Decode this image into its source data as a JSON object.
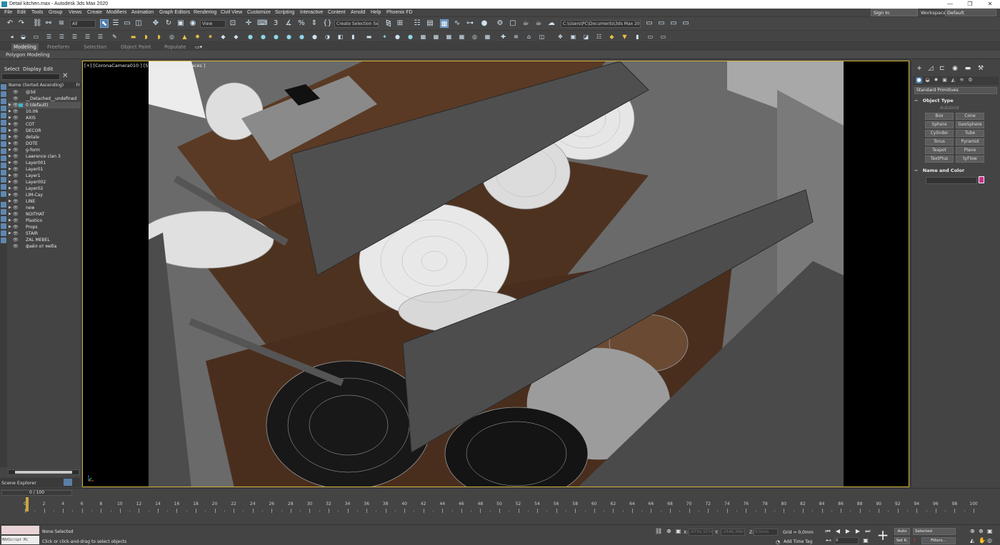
{
  "window": {
    "title": "Detail kitchen.max - Autodesk 3ds Max 2020",
    "minimize": "—",
    "maximize": "❐",
    "close": "✕"
  },
  "menu": [
    "File",
    "Edit",
    "Tools",
    "Group",
    "Views",
    "Create",
    "Modifiers",
    "Animation",
    "Graph Editors",
    "Rendering",
    "Civil View",
    "Customize",
    "Scripting",
    "Interactive",
    "Content",
    "Arnold",
    "Help",
    "Phoenix FD"
  ],
  "account": {
    "sign_in": "Sign In",
    "workspaces_label": "Workspaces:",
    "workspace": "Default"
  },
  "toolbar": {
    "filter": "All",
    "view": "View",
    "selection_set": "Create Selection Set",
    "project_path": "C:\\Users\\PC\\Documents\\3ds Max 2020"
  },
  "ribbon": {
    "tabs": [
      "Modeling",
      "Freeform",
      "Selection",
      "Object Paint",
      "Populate"
    ],
    "active_tab": "Modeling",
    "panel": "Polygon Modeling"
  },
  "scene_explorer": {
    "menu": [
      "Select",
      "Display",
      "Edit"
    ],
    "column_header": "Name (Sorted Ascending)",
    "column_header_2": "Fr",
    "footer": "Scene Explorer",
    "layers": [
      "@3d",
      "__Detached__undefined",
      "0 (default)",
      "10.06",
      "AXIS",
      "COT",
      "DECOR",
      "detale",
      "DOTE",
      "g-form",
      "Lawrence clan 3",
      "Layer001",
      "Layer01",
      "Layer1",
      "Layer002",
      "Layer02",
      "LIM-Cay",
      "LINE",
      "new",
      "NOITHAT",
      "Plastico",
      "Props",
      "STAIR",
      "ZAL MEBEL",
      "файл от меба"
    ]
  },
  "viewport": {
    "label": "[+] [CoronaCamera010 ] [Standard ] [Edged Faces ]"
  },
  "command_panel": {
    "category": "Standard Primitives",
    "object_type_title": "Object Type",
    "autogrid": "AutoGrid",
    "primitives": [
      "Box",
      "Cone",
      "Sphere",
      "GeoSphere",
      "Cylinder",
      "Tube",
      "Torus",
      "Pyramid",
      "Teapot",
      "Plane",
      "TextPlus",
      "tyFlow"
    ],
    "name_color_title": "Name and Color",
    "object_color": "#d12e8e"
  },
  "timeline": {
    "frame_display": "0 / 100",
    "ticks": [
      "0",
      "2",
      "4",
      "6",
      "8",
      "10",
      "12",
      "14",
      "16",
      "18",
      "20",
      "22",
      "24",
      "26",
      "28",
      "30",
      "32",
      "34",
      "36",
      "38",
      "40",
      "42",
      "44",
      "46",
      "48",
      "50",
      "52",
      "54",
      "56",
      "58",
      "60",
      "62",
      "64",
      "66",
      "68",
      "70",
      "72",
      "74",
      "76",
      "78",
      "80",
      "82",
      "84",
      "86",
      "88",
      "90",
      "92",
      "94",
      "96",
      "98",
      "100"
    ]
  },
  "status": {
    "maxscript": "MAXScript Mi",
    "selection": "None Selected",
    "prompt": "Click or click-and-drag to select objects",
    "x_label": "X:",
    "x_value": "-6730,327m",
    "y_label": "Y:",
    "y_value": "-2546,396r",
    "z_label": "Z:",
    "z_value": "0,0mm",
    "grid": "Grid = 0,0mm",
    "add_time_tag": "Add Time Tag",
    "auto": "Auto",
    "set_key": "Set K.",
    "selected": "Selected",
    "filters": "Filters...",
    "frame": "0"
  }
}
